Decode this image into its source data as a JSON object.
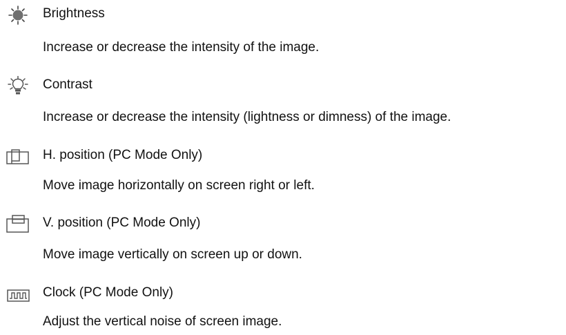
{
  "items": [
    {
      "icon": "brightness-sun-icon",
      "title": "Brightness",
      "description": "Increase or decrease the intensity of the image."
    },
    {
      "icon": "contrast-bulb-icon",
      "title": "Contrast",
      "description": "Increase or decrease the intensity (lightness or dimness) of the image."
    },
    {
      "icon": "horizontal-position-icon",
      "title": "H. position (PC Mode Only)",
      "description": "Move image horizontally on screen right or left."
    },
    {
      "icon": "vertical-position-icon",
      "title": "V. position (PC Mode Only)",
      "description": "Move image vertically on screen up or down."
    },
    {
      "icon": "clock-waveform-icon",
      "title": "Clock (PC Mode Only)",
      "description": "Adjust the vertical noise of screen image."
    }
  ]
}
